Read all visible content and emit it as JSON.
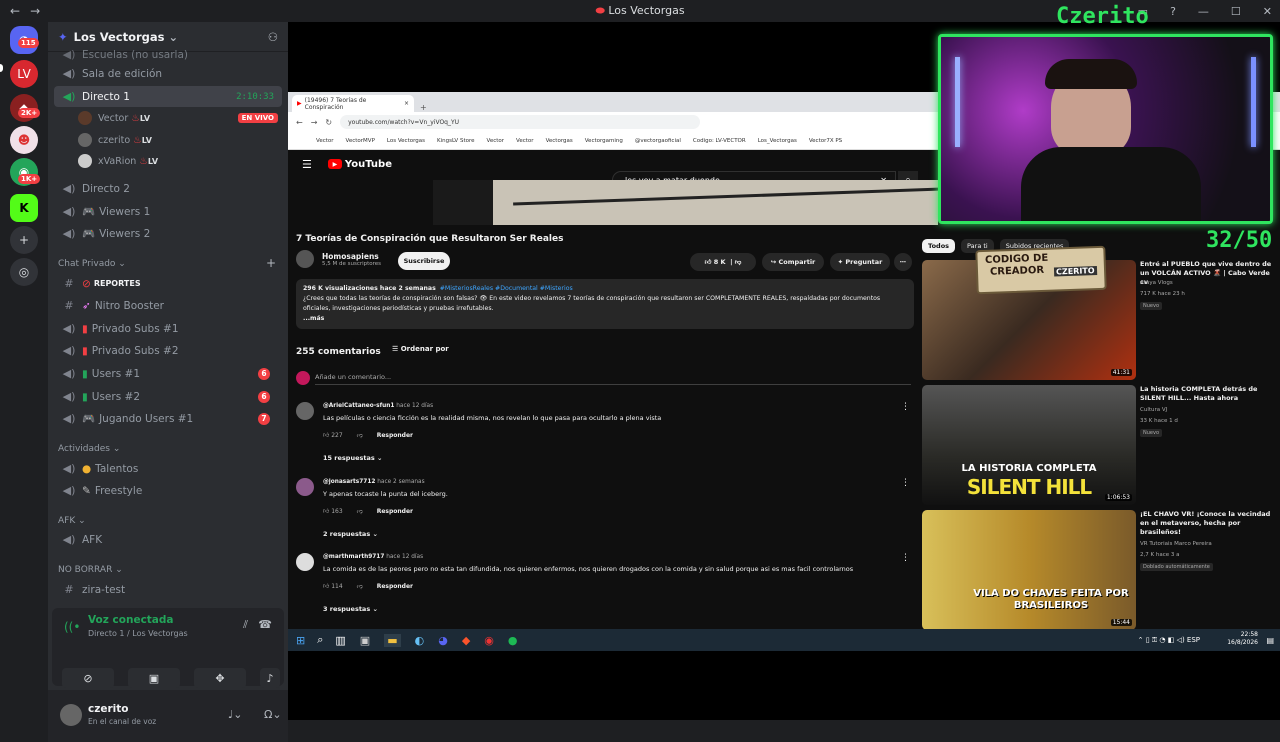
{
  "window": {
    "title": "Los Vectorgas",
    "back": "←",
    "forward": "→"
  },
  "rail": {
    "dm_badge": "115",
    "badge_2k": "2K+",
    "badge_1k": "1K+",
    "badge_4": "4"
  },
  "server": {
    "name": "Los Vectorgas"
  },
  "channels": {
    "partial_top": "Escuelas (no usarla)",
    "sala_edicion": "Sala de edición",
    "directo1": "Directo 1",
    "directo1_time": "2:10:33",
    "live_label": "EN VIVO",
    "users": [
      {
        "name": "Vector",
        "tag": "LV"
      },
      {
        "name": "czerito",
        "tag": "LV"
      },
      {
        "name": "xVaRion",
        "tag": "LV"
      }
    ],
    "directo2": "Directo 2",
    "viewers1": "Viewers 1",
    "viewers2": "Viewers 2",
    "cat_chat": "Chat Privado",
    "reportes": "REPORTES",
    "nitro": "Nitro Booster",
    "priv1": "Privado Subs #1",
    "priv2": "Privado Subs #2",
    "users1": "Users #1",
    "users1_count": "6",
    "users2": "Users #2",
    "users2_count": "6",
    "jugando": "Jugando Users #1",
    "jugando_count": "7",
    "cat_act": "Actividades",
    "talentos": "Talentos",
    "freestyle": "Freestyle",
    "cat_afk": "AFK",
    "afk": "AFK",
    "cat_nb": "NO BORRAR",
    "zira": "zira-test"
  },
  "voice": {
    "status": "Voz conectada",
    "location": "Directo 1 / Los Vectorgas"
  },
  "me": {
    "name": "czerito",
    "status": "En el canal de voz"
  },
  "browser": {
    "tab": "(19496) 7 Teorías de Conspiración",
    "url": "youtube.com/watch?v=Vn_yiVOq_YU",
    "bookmarks": [
      "Vector",
      "VectorMVP",
      "Los Vectorgas",
      "KingsLV Store",
      "Vector",
      "Vector",
      "Vectorgas",
      "Vectorgaming",
      "@vectorgaoficial",
      "Codigo: LV-VECTOR",
      "Los_Vectorgas",
      "Vector7X PS"
    ]
  },
  "youtube": {
    "logo": "YouTube",
    "search": "los voy a matar duende",
    "title": "7 Teorías de Conspiración que Resultaron Ser Reales",
    "channel": "Homosapiens",
    "subs": "5,5 M de suscriptores",
    "subscribe": "Suscribirse",
    "likes": "8 K",
    "share": "Compartir",
    "ask": "Preguntar",
    "desc_stats": "296 K visualizaciones  hace 2 semanas",
    "desc_tags": "#MisteriosReales #Documental #Misterios",
    "desc_text": "¿Crees que todas las teorías de conspiración son falsas? 👁 En este video revelamos 7 teorías de conspiración que resultaron ser COMPLETAMENTE REALES, respaldadas por documentos oficiales, investigaciones periodísticas y pruebas irrefutables.",
    "desc_more": "...más",
    "comments_count": "255 comentarios",
    "sort": "Ordenar por",
    "add_comment": "Añade un comentario...",
    "comments": [
      {
        "author": "@ArielCattaneo-sfun1",
        "time": "hace 12 días",
        "text": "Las películas o ciencia ficción es la realidad misma, nos revelan lo que pasa para ocultarlo a plena vista",
        "likes": "227",
        "reply": "Responder",
        "replies": "15 respuestas"
      },
      {
        "author": "@jonasarts7712",
        "time": "hace 2 semanas",
        "text": "Y apenas tocaste la punta del iceberg.",
        "likes": "163",
        "reply": "Responder",
        "replies": "2 respuestas"
      },
      {
        "author": "@marthmarth9717",
        "time": "hace 12 días",
        "text": "La comida es de las peores pero no esta tan difundida, nos quieren enfermos, nos quieren drogados con la comida y sin salud porque asi es mas facil controlarnos",
        "likes": "114",
        "reply": "Responder",
        "replies": "3 respuestas"
      }
    ],
    "chips": [
      "Todos",
      "Para ti",
      "Subidos recientes"
    ],
    "recs": [
      {
        "title": "Entré al PUEBLO que vive dentro de un VOLCÁN ACTIVO 🌋 | Cabo Verde cv",
        "channel": "Araya Vlogs",
        "meta": "717 K  hace 23 h",
        "badge": "Nuevo",
        "dur": "41:31",
        "color": "#6b4a3a"
      },
      {
        "title": "La historia COMPLETA detrás de SILENT HILL... Hasta ahora",
        "channel": "Cultura VJ",
        "meta": "33 K  hace 1 d",
        "badge": "Nuevo",
        "dur": "1:06:53",
        "color": "#3a3a36",
        "thumb_text": "LA HISTORIA COMPLETA",
        "thumb_big": "SILENT HILL"
      },
      {
        "title": "¡EL CHAVO VR! ¡Conoce la vecindad en el metaverso, hecha por brasileños!",
        "channel": "VR Tutoriais Marco Pereira",
        "meta": "2,7 K  hace 3 a",
        "badge": "Doblado automáticamente",
        "dur": "15:44",
        "color": "#c9a640",
        "thumb_text": "VILA DO CHAVES FEITA POR BRASILEIROS"
      }
    ]
  },
  "overlay": {
    "name": "Czerito",
    "score": "32/50",
    "code_label": "CODIGO DE CREADOR",
    "code_name": "CZERITO"
  },
  "taskbar": {
    "lang": "ESP",
    "time": "22:58",
    "date": "16/8/2026"
  },
  "colors": {
    "accent_green": "#2fe55f",
    "discord_red": "#f23f43",
    "voice_green": "#23a55a"
  }
}
